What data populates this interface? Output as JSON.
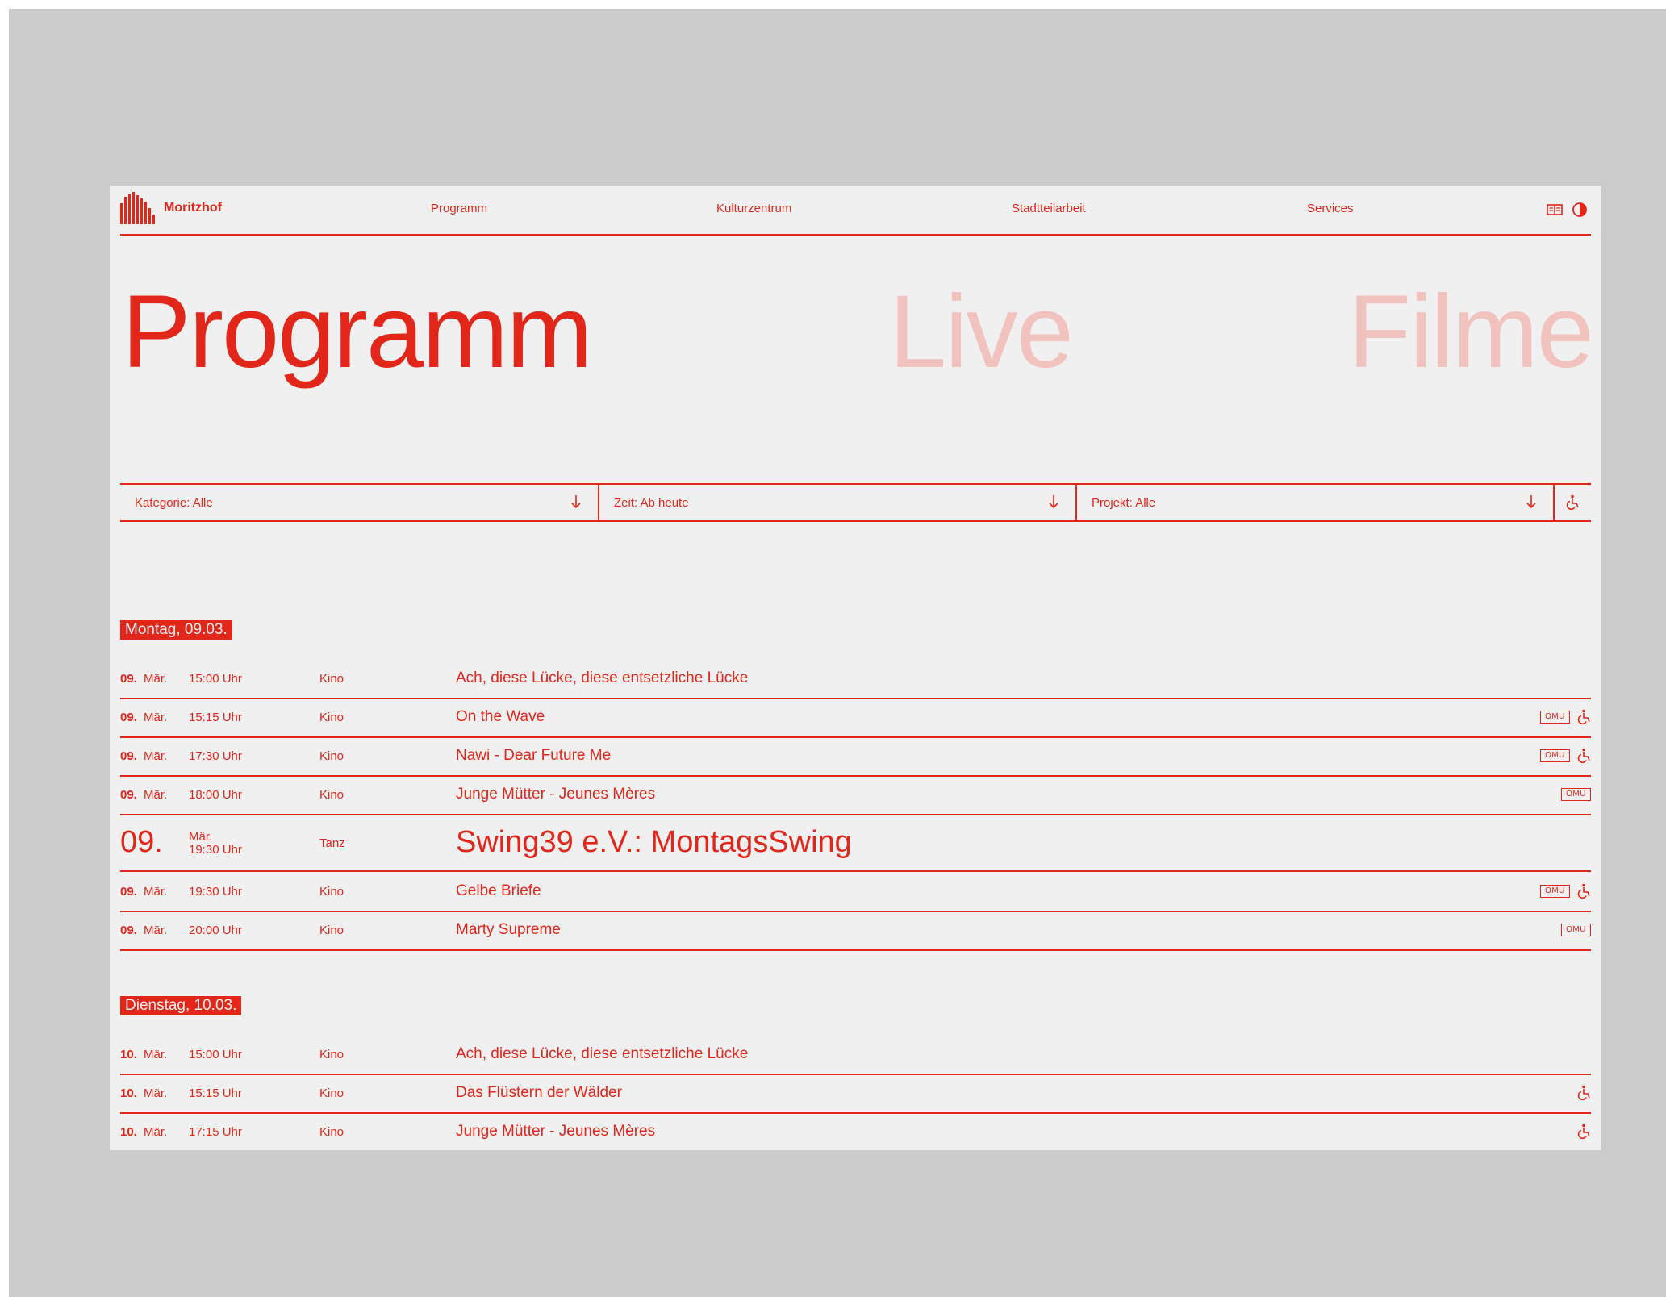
{
  "header": {
    "logo_text": "Moritzhof",
    "nav": [
      "Programm",
      "Kulturzentrum",
      "Stadtteilarbeit",
      "Services"
    ],
    "icons": [
      "book-icon",
      "contrast-icon"
    ]
  },
  "tabs": [
    "Programm",
    "Live",
    "Filme"
  ],
  "filters": {
    "kategorie": "Kategorie: Alle",
    "zeit": "Zeit: Ab heute",
    "projekt": "Projekt: Alle"
  },
  "days": [
    {
      "label": "Montag, 09.03.",
      "events": [
        {
          "day": "09.",
          "month": "Mär.",
          "time": "15:00 Uhr",
          "category": "Kino",
          "title": "Ach, diese Lücke, diese entsetzliche Lücke",
          "omu": false,
          "accessible": false
        },
        {
          "day": "09.",
          "month": "Mär.",
          "time": "15:15 Uhr",
          "category": "Kino",
          "title": "On the Wave",
          "omu": true,
          "accessible": true
        },
        {
          "day": "09.",
          "month": "Mär.",
          "time": "17:30 Uhr",
          "category": "Kino",
          "title": "Nawi - Dear Future Me",
          "omu": true,
          "accessible": true
        },
        {
          "day": "09.",
          "month": "Mär.",
          "time": "18:00 Uhr",
          "category": "Kino",
          "title": "Junge Mütter - Jeunes Mères",
          "omu": true,
          "accessible": false
        },
        {
          "day": "09.",
          "month": "Mär.",
          "time": "19:30 Uhr",
          "category": "Tanz",
          "title": "Swing39 e.V.: MontagsSwing",
          "omu": false,
          "accessible": false,
          "featured": true
        },
        {
          "day": "09.",
          "month": "Mär.",
          "time": "19:30 Uhr",
          "category": "Kino",
          "title": "Gelbe Briefe",
          "omu": true,
          "accessible": true
        },
        {
          "day": "09.",
          "month": "Mär.",
          "time": "20:00 Uhr",
          "category": "Kino",
          "title": "Marty Supreme",
          "omu": true,
          "accessible": false
        }
      ]
    },
    {
      "label": "Dienstag, 10.03.",
      "events": [
        {
          "day": "10.",
          "month": "Mär.",
          "time": "15:00 Uhr",
          "category": "Kino",
          "title": "Ach, diese Lücke, diese entsetzliche Lücke",
          "omu": false,
          "accessible": false
        },
        {
          "day": "10.",
          "month": "Mär.",
          "time": "15:15 Uhr",
          "category": "Kino",
          "title": "Das Flüstern der Wälder",
          "omu": false,
          "accessible": true
        },
        {
          "day": "10.",
          "month": "Mär.",
          "time": "17:15 Uhr",
          "category": "Kino",
          "title": "Junge Mütter - Jeunes Mères",
          "omu": false,
          "accessible": true
        }
      ]
    }
  ],
  "badge_omu": "OMU",
  "colors": {
    "accent": "#e2261a",
    "accent_light": "#f2c2bf",
    "page_bg": "#f1f0f1",
    "outer_bg": "#cbcbcb"
  }
}
